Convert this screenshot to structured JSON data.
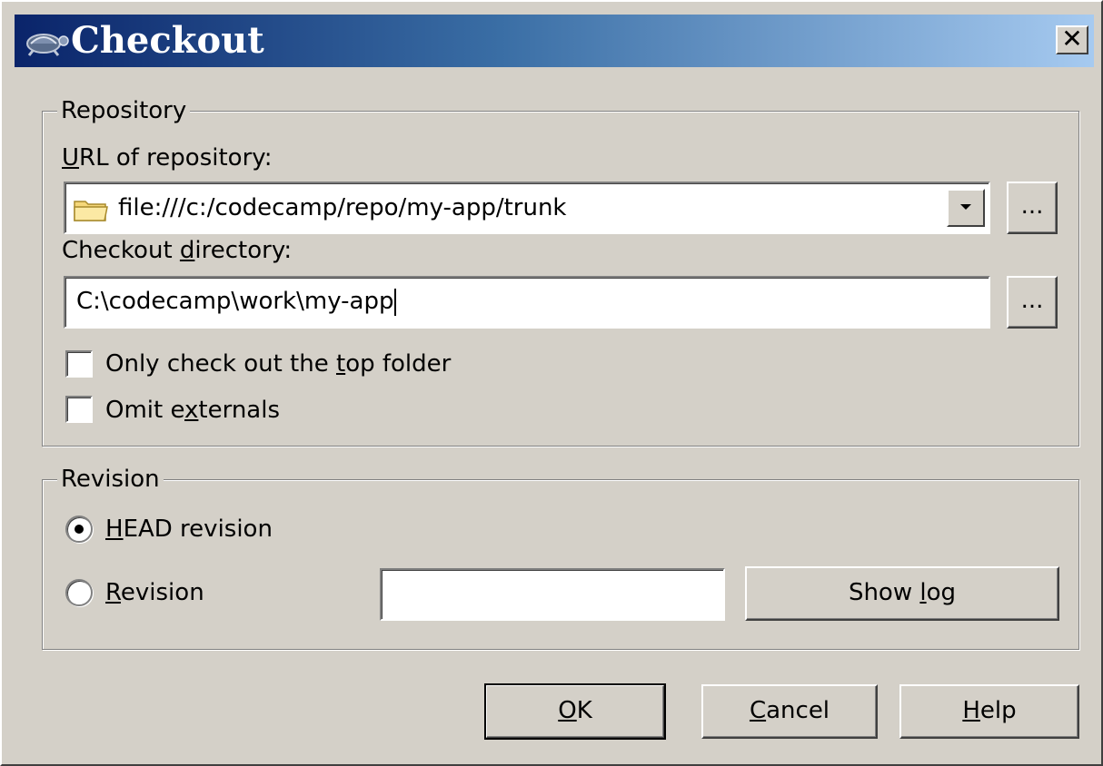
{
  "window": {
    "title": "Checkout",
    "close_label": "✕"
  },
  "repository": {
    "group_label": "Repository",
    "url_label_pre": "",
    "url_label_key": "U",
    "url_label_post": "RL of repository:",
    "url_value": "file:///c:/codecamp/repo/my-app/trunk",
    "url_browse_label": "...",
    "dir_label_pre": "Checkout ",
    "dir_label_key": "d",
    "dir_label_post": "irectory:",
    "dir_value": "C:\\codecamp\\work\\my-app",
    "dir_browse_label": "...",
    "top_folder": {
      "label_pre": "Only check out the ",
      "label_key": "t",
      "label_post": "op folder",
      "checked": false
    },
    "omit_externals": {
      "label_pre": "Omit e",
      "label_key": "x",
      "label_post": "ternals",
      "checked": false
    }
  },
  "revision": {
    "group_label": "Revision",
    "head": {
      "label_pre": "",
      "label_key": "H",
      "label_post": "EAD revision",
      "selected": true
    },
    "specific": {
      "label_pre": "",
      "label_key": "R",
      "label_post": "evision",
      "selected": false,
      "value": ""
    },
    "show_log": {
      "label_pre": "Show ",
      "label_key": "l",
      "label_post": "og"
    }
  },
  "buttons": {
    "ok": {
      "label_pre": "",
      "label_key": "O",
      "label_post": "K"
    },
    "cancel": {
      "label_pre": "",
      "label_key": "C",
      "label_post": "ancel"
    },
    "help": {
      "label_pre": "",
      "label_key": "H",
      "label_post": "elp"
    }
  }
}
